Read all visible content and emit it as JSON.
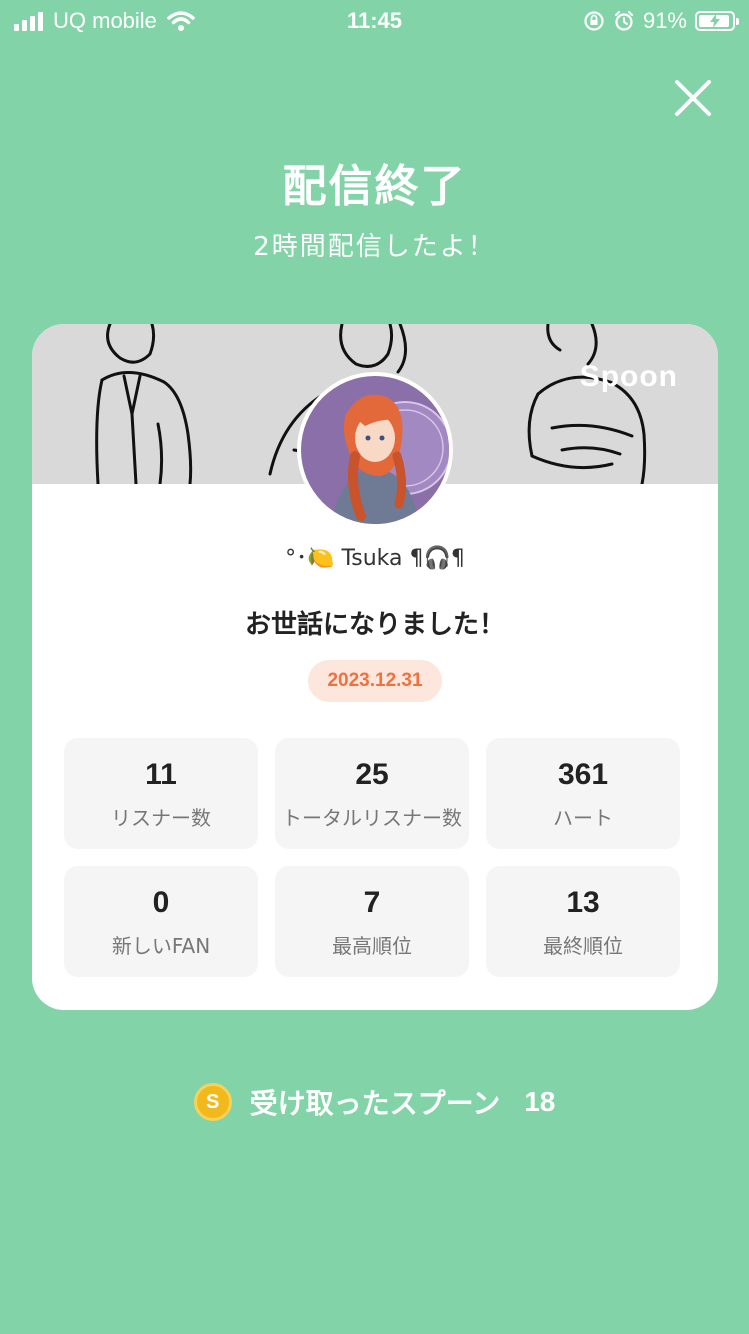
{
  "status_bar": {
    "carrier": "UQ mobile",
    "time": "11:45",
    "battery": "91%"
  },
  "header": {
    "title": "配信終了",
    "subtitle": "2時間配信したよ！"
  },
  "card": {
    "brand": "Spoon",
    "username": "°･🍋 Tsuka ¶🎧¶",
    "message": "お世話になりました！",
    "date": "2023.12.31",
    "stats": [
      {
        "value": "11",
        "label": "リスナー数"
      },
      {
        "value": "25",
        "label": "トータルリスナー数"
      },
      {
        "value": "361",
        "label": "ハート"
      },
      {
        "value": "0",
        "label": "新しいFAN"
      },
      {
        "value": "7",
        "label": "最高順位"
      },
      {
        "value": "13",
        "label": "最終順位"
      }
    ]
  },
  "spoons": {
    "coin_symbol": "S",
    "label": "受け取ったスプーン",
    "count": "18"
  },
  "colors": {
    "background": "#82d4a8",
    "date_badge_bg": "#fde6dc",
    "date_text": "#f0713f",
    "coin": "#f2b91c"
  }
}
